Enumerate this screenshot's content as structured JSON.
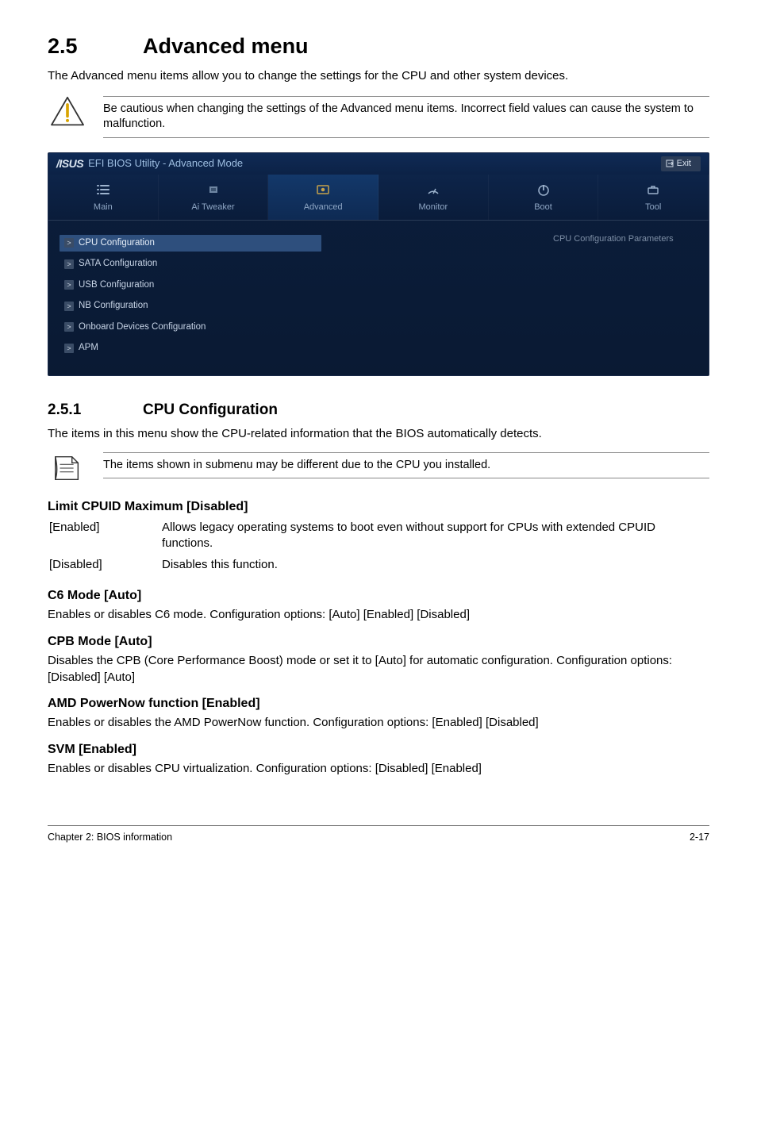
{
  "section": {
    "number": "2.5",
    "title": "Advanced menu"
  },
  "intro": "The Advanced menu items allow you to change the settings for the CPU and other system devices.",
  "warning_note": "Be cautious when changing the settings of the Advanced menu items. Incorrect field values can cause the system to malfunction.",
  "bios": {
    "logo_text": "/ISUS",
    "utility_title": "EFI BIOS Utility - Advanced Mode",
    "exit_label": "Exit",
    "tabs": [
      {
        "label": "Main"
      },
      {
        "label": "Ai  Tweaker"
      },
      {
        "label": "Advanced"
      },
      {
        "label": "Monitor"
      },
      {
        "label": "Boot"
      },
      {
        "label": "Tool"
      }
    ],
    "right_panel": "CPU Configuration Parameters",
    "menu": [
      {
        "label": "CPU Configuration",
        "selected": true
      },
      {
        "label": "SATA Configuration"
      },
      {
        "label": "USB Configuration"
      },
      {
        "label": "NB Configuration"
      },
      {
        "label": "Onboard Devices Configuration"
      },
      {
        "label": "APM"
      }
    ]
  },
  "subsection": {
    "number": "2.5.1",
    "title": "CPU Configuration"
  },
  "subsection_intro": "The items in this menu show the CPU-related information that the BIOS automatically detects.",
  "info_note": "The items shown in submenu may be different due to the CPU you installed.",
  "settings": [
    {
      "title": "Limit CPUID Maximum [Disabled]",
      "options": [
        {
          "key": "[Enabled]",
          "val": "Allows legacy operating systems to boot even without support for CPUs with extended CPUID functions."
        },
        {
          "key": "[Disabled]",
          "val": "Disables this function."
        }
      ]
    },
    {
      "title": "C6 Mode [Auto]",
      "body": "Enables or disables C6 mode. Configuration options: [Auto] [Enabled] [Disabled]"
    },
    {
      "title": "CPB Mode [Auto]",
      "body": "Disables the CPB (Core Performance Boost) mode or set it to [Auto] for automatic configuration. Configuration options: [Disabled] [Auto]"
    },
    {
      "title": "AMD PowerNow function [Enabled]",
      "body": "Enables or disables the AMD PowerNow function. Configuration options: [Enabled] [Disabled]"
    },
    {
      "title": "SVM [Enabled]",
      "body": "Enables or disables CPU virtualization. Configuration options: [Disabled] [Enabled]"
    }
  ],
  "footer": {
    "left": "Chapter 2: BIOS information",
    "right": "2-17"
  }
}
